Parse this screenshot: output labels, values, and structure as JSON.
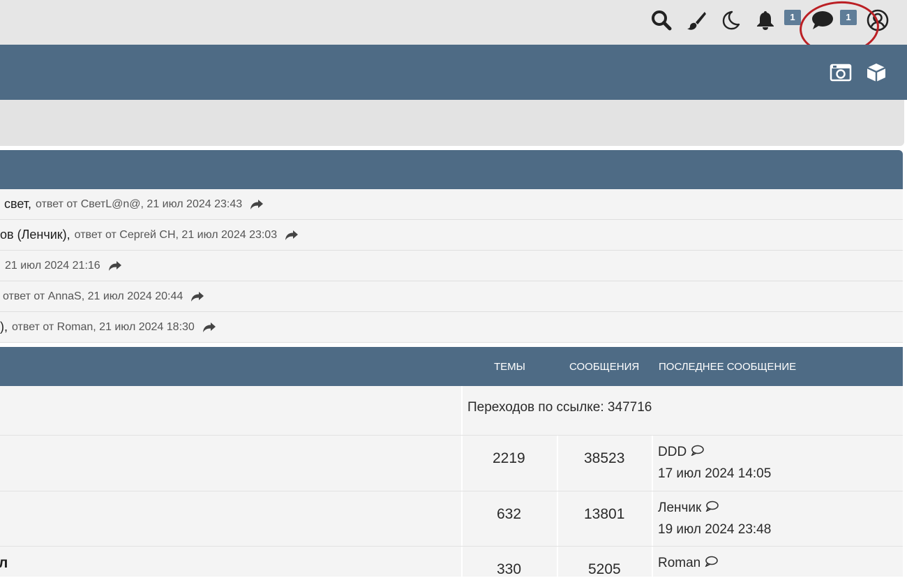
{
  "header": {
    "notifications_count": "1",
    "messages_count": "1",
    "icons": [
      "search-icon",
      "brush-icon",
      "moon-icon",
      "bell-icon",
      "chat-icon",
      "user-circle-icon"
    ]
  },
  "navbar": {
    "icons": [
      "camera-icon",
      "box-icon"
    ]
  },
  "recent_topics": [
    {
      "title": "свет,",
      "meta": "ответ от СветL@n@, 21 июл 2024 23:43"
    },
    {
      "title": "ов (Ленчик),",
      "meta": "ответ от Сергей СН, 21 июл 2024 23:03"
    },
    {
      "title": "",
      "meta": "21 июл 2024 21:16"
    },
    {
      "title": "",
      "meta": "ответ от AnnaS, 21 июл 2024 20:44"
    },
    {
      "title": "),",
      "meta": "ответ от Roman, 21 июл 2024 18:30"
    }
  ],
  "forum_table": {
    "col_topics": "ТЕМЫ",
    "col_posts": "СООБЩЕНИЯ",
    "col_last": "ПОСЛЕДНЕЕ СООБЩЕНИЕ",
    "link_row": "Переходов по ссылке: 347716",
    "rows": [
      {
        "topics": "2219",
        "posts": "38523",
        "last_user": "DDD",
        "last_date": "17 июл 2024 14:05"
      },
      {
        "topics": "632",
        "posts": "13801",
        "last_user": "Ленчик",
        "last_date": "19 июл 2024 23:48"
      },
      {
        "topics": "330",
        "posts": "5205",
        "last_user": "Roman",
        "last_date": ""
      }
    ],
    "partial_title": "л"
  },
  "colors": {
    "header_bg": "#e6e6e6",
    "nav_bg": "#4e6b85",
    "badge": "#5f7d98",
    "annotation": "#bb1f24"
  }
}
